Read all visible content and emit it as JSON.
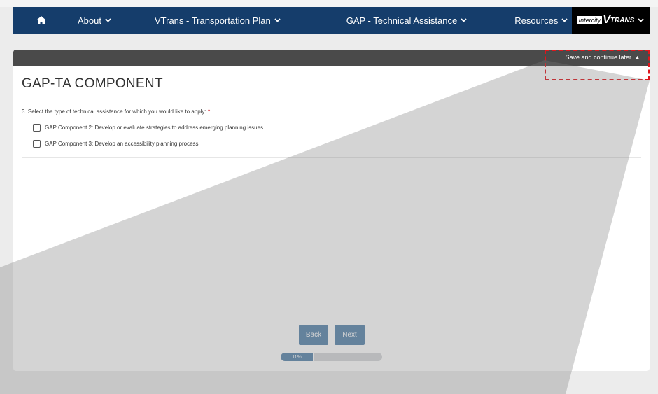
{
  "nav": {
    "items": [
      {
        "label": "About"
      },
      {
        "label": "VTrans - Transportation Plan"
      },
      {
        "label": "GAP - Technical Assistance"
      },
      {
        "label": "Resources"
      }
    ],
    "brand": {
      "box_text": "Intercity",
      "v": "V",
      "rest": "TRANS"
    }
  },
  "form": {
    "save_later": "Save and continue later",
    "title": "GAP-TA COMPONENT",
    "question": "3. Select the type of technical assistance for which you would like to apply:",
    "required_marker": "*",
    "options": [
      {
        "label": "GAP Component 2: Develop or evaluate strategies to address emerging planning issues.",
        "checked": false
      },
      {
        "label": "GAP Component 3: Develop an accessibility planning process.",
        "checked": false
      }
    ],
    "back_label": "Back",
    "next_label": "Next",
    "progress": {
      "label": "11%",
      "value": 0.11
    }
  },
  "colors": {
    "navbar": "#153d6b",
    "accent": "#5b86ad",
    "header_bar": "#4a4a4a",
    "highlight": "#e0151b",
    "required": "#d9232d"
  }
}
